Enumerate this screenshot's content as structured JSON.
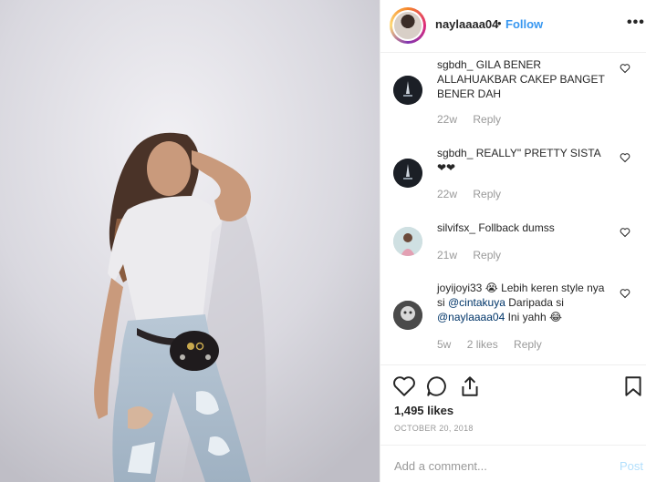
{
  "post": {
    "username": "naylaaaa04",
    "separator": "•",
    "follow_label": "Follow",
    "more_label": "•••",
    "likes": "1,495 likes",
    "date": "OCTOBER 20, 2018"
  },
  "comments": [
    {
      "user": "sgbdh_",
      "text": " GILA BENER ALLAHUAKBAR CAKEP BANGET BENER DAH",
      "time": "22w",
      "likes": "",
      "reply": "Reply"
    },
    {
      "user": "sgbdh_",
      "text": " REALLY\" PRETTY SISTA❤❤",
      "time": "22w",
      "likes": "",
      "reply": "Reply"
    },
    {
      "user": "silvifsx_",
      "text": " Follback dumss",
      "time": "21w",
      "likes": "",
      "reply": "Reply"
    },
    {
      "user": "joyijoyi33",
      "text_emoji": "😭",
      "text_a": " Lebih keren style nya si ",
      "mention_a": "@cintakuya",
      "text_b": " Daripada si ",
      "mention_b": "@naylaaaa04",
      "text_c": " Ini yahh ",
      "text_emoji2": "😂",
      "time": "5w",
      "likes": "2 likes",
      "reply": "Reply"
    }
  ],
  "add_comment": {
    "placeholder": "Add a comment...",
    "post_label": "Post"
  },
  "colors": {
    "accent": "#3897f0",
    "meta": "#999999",
    "border": "#efefef"
  },
  "icons": [
    "heart-icon",
    "comment-icon",
    "share-icon",
    "bookmark-icon",
    "more-options-icon"
  ]
}
